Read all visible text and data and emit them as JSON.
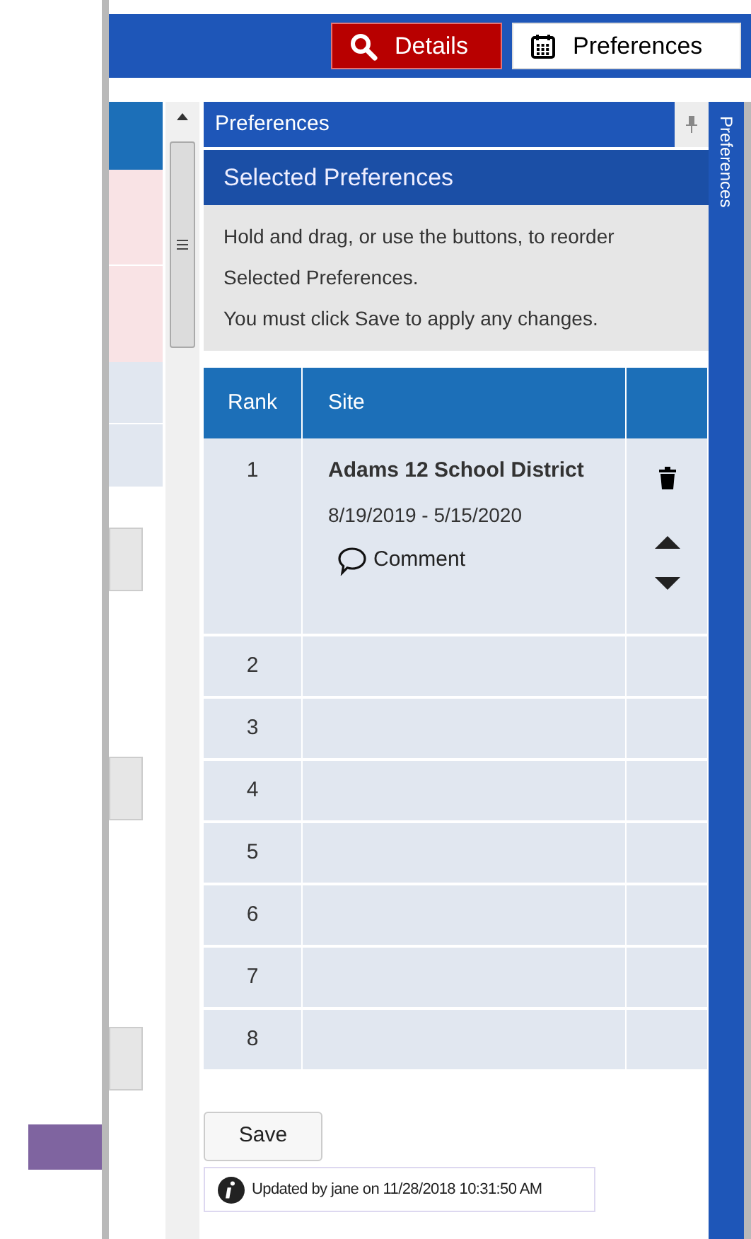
{
  "toolbar": {
    "buttons": [
      {
        "label": "Details",
        "kind": "search",
        "selected": true
      },
      {
        "label": "Preferences",
        "kind": "calendar",
        "selected": false
      }
    ]
  },
  "panel": {
    "title": "Preferences",
    "side_tab": "Preferences",
    "section_title": "Selected Preferences",
    "instructions": [
      "Hold and drag, or use the buttons, to reorder",
      "Selected Preferences.",
      "You must click Save to apply any changes."
    ]
  },
  "table": {
    "columns": [
      "Rank",
      "Site"
    ],
    "rows": [
      {
        "rank": "1",
        "site": "Adams 12 School District",
        "dates": "8/19/2019 - 5/15/2020",
        "comment": "Comment"
      },
      {
        "rank": "2"
      },
      {
        "rank": "3"
      },
      {
        "rank": "4"
      },
      {
        "rank": "5"
      },
      {
        "rank": "6"
      },
      {
        "rank": "7"
      },
      {
        "rank": "8"
      }
    ]
  },
  "save_button": "Save",
  "status": "Updated by jane on 11/28/2018 10:31:50 AM"
}
